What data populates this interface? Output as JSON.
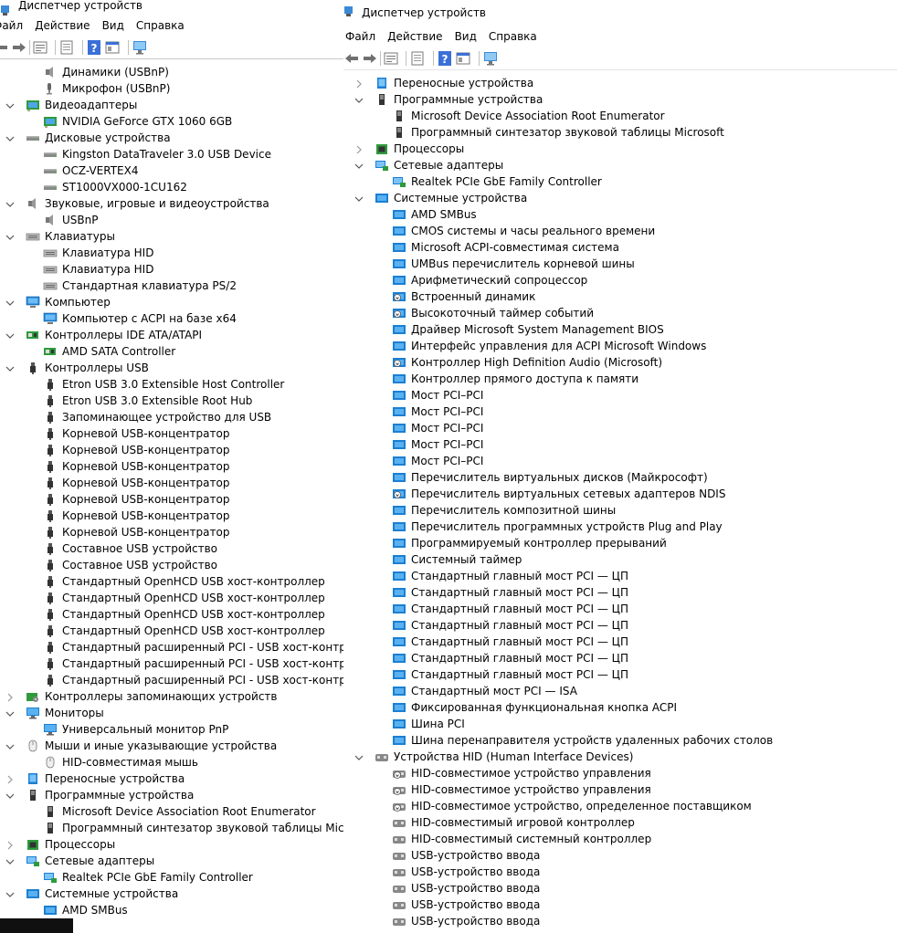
{
  "window_left": {
    "title": "Диспетчер устройств",
    "menu": [
      "Файл",
      "Действие",
      "Вид",
      "Справка"
    ],
    "tree": [
      {
        "label": "Динамики (USBnP)",
        "level": 1,
        "icon": "speaker-icon"
      },
      {
        "label": "Микрофон (USBnP)",
        "level": 1,
        "icon": "microphone-icon"
      },
      {
        "label": "Видеоадаптеры",
        "level": 0,
        "expanded": true,
        "icon": "display-adapter-icon"
      },
      {
        "label": "NVIDIA GeForce GTX 1060 6GB",
        "level": 1,
        "icon": "display-adapter-icon"
      },
      {
        "label": "Дисковые устройства",
        "level": 0,
        "expanded": true,
        "icon": "disk-drive-icon"
      },
      {
        "label": "Kingston DataTraveler 3.0 USB Device",
        "level": 1,
        "icon": "disk-drive-icon"
      },
      {
        "label": "OCZ-VERTEX4",
        "level": 1,
        "icon": "disk-drive-icon"
      },
      {
        "label": "ST1000VX000-1CU162",
        "level": 1,
        "icon": "disk-drive-icon"
      },
      {
        "label": "Звуковые, игровые и видеоустройства",
        "level": 0,
        "expanded": true,
        "icon": "speaker-icon"
      },
      {
        "label": "USBnP",
        "level": 1,
        "icon": "speaker-icon"
      },
      {
        "label": "Клавиатуры",
        "level": 0,
        "expanded": true,
        "icon": "keyboard-icon"
      },
      {
        "label": "Клавиатура HID",
        "level": 1,
        "icon": "keyboard-icon"
      },
      {
        "label": "Клавиатура HID",
        "level": 1,
        "icon": "keyboard-icon"
      },
      {
        "label": "Стандартная клавиатура PS/2",
        "level": 1,
        "icon": "keyboard-icon"
      },
      {
        "label": "Компьютер",
        "level": 0,
        "expanded": true,
        "icon": "computer-icon"
      },
      {
        "label": "Компьютер с ACPI на базе x64",
        "level": 1,
        "icon": "computer-icon"
      },
      {
        "label": "Контроллеры IDE ATA/ATAPI",
        "level": 0,
        "expanded": true,
        "icon": "ide-controller-icon"
      },
      {
        "label": "AMD SATA Controller",
        "level": 1,
        "icon": "ide-controller-icon"
      },
      {
        "label": "Контроллеры USB",
        "level": 0,
        "expanded": true,
        "icon": "usb-icon"
      },
      {
        "label": "Etron USB 3.0 Extensible Host Controller",
        "level": 1,
        "icon": "usb-icon"
      },
      {
        "label": "Etron USB 3.0 Extensible Root Hub",
        "level": 1,
        "icon": "usb-icon"
      },
      {
        "label": "Запоминающее устройство для USB",
        "level": 1,
        "icon": "usb-icon"
      },
      {
        "label": "Корневой USB-концентратор",
        "level": 1,
        "icon": "usb-icon"
      },
      {
        "label": "Корневой USB-концентратор",
        "level": 1,
        "icon": "usb-icon"
      },
      {
        "label": "Корневой USB-концентратор",
        "level": 1,
        "icon": "usb-icon"
      },
      {
        "label": "Корневой USB-концентратор",
        "level": 1,
        "icon": "usb-icon"
      },
      {
        "label": "Корневой USB-концентратор",
        "level": 1,
        "icon": "usb-icon"
      },
      {
        "label": "Корневой USB-концентратор",
        "level": 1,
        "icon": "usb-icon"
      },
      {
        "label": "Корневой USB-концентратор",
        "level": 1,
        "icon": "usb-icon"
      },
      {
        "label": "Составное USB устройство",
        "level": 1,
        "icon": "usb-icon"
      },
      {
        "label": "Составное USB устройство",
        "level": 1,
        "icon": "usb-icon"
      },
      {
        "label": "Стандартный OpenHCD USB хост-контроллер",
        "level": 1,
        "icon": "usb-icon"
      },
      {
        "label": "Стандартный OpenHCD USB хост-контроллер",
        "level": 1,
        "icon": "usb-icon"
      },
      {
        "label": "Стандартный OpenHCD USB хост-контроллер",
        "level": 1,
        "icon": "usb-icon"
      },
      {
        "label": "Стандартный OpenHCD USB хост-контроллер",
        "level": 1,
        "icon": "usb-icon"
      },
      {
        "label": "Стандартный расширенный PCI - USB хост-контроллер",
        "level": 1,
        "icon": "usb-icon"
      },
      {
        "label": "Стандартный расширенный PCI - USB хост-контроллер",
        "level": 1,
        "icon": "usb-icon"
      },
      {
        "label": "Стандартный расширенный PCI - USB хост-контроллер",
        "level": 1,
        "icon": "usb-icon"
      },
      {
        "label": "Контроллеры запоминающих устройств",
        "level": 0,
        "expanded": false,
        "icon": "storage-controller-icon"
      },
      {
        "label": "Мониторы",
        "level": 0,
        "expanded": true,
        "icon": "monitor-icon"
      },
      {
        "label": "Универсальный монитор PnP",
        "level": 1,
        "icon": "monitor-icon"
      },
      {
        "label": "Мыши и иные указывающие устройства",
        "level": 0,
        "expanded": true,
        "icon": "mouse-icon"
      },
      {
        "label": "HID-совместимая мышь",
        "level": 1,
        "icon": "mouse-icon"
      },
      {
        "label": "Переносные устройства",
        "level": 0,
        "expanded": false,
        "icon": "portable-device-icon"
      },
      {
        "label": "Программные устройства",
        "level": 0,
        "expanded": true,
        "icon": "software-device-icon"
      },
      {
        "label": "Microsoft Device Association Root Enumerator",
        "level": 1,
        "icon": "software-device-icon"
      },
      {
        "label": "Программный синтезатор звуковой таблицы Microsoft",
        "level": 1,
        "icon": "software-device-icon"
      },
      {
        "label": "Процессоры",
        "level": 0,
        "expanded": false,
        "icon": "processor-icon"
      },
      {
        "label": "Сетевые адаптеры",
        "level": 0,
        "expanded": true,
        "icon": "network-adapter-icon"
      },
      {
        "label": "Realtek PCIe GbE Family Controller",
        "level": 1,
        "icon": "network-adapter-icon"
      },
      {
        "label": "Системные устройства",
        "level": 0,
        "expanded": true,
        "icon": "system-device-icon"
      },
      {
        "label": "AMD SMBus",
        "level": 1,
        "icon": "system-device-icon"
      }
    ]
  },
  "window_right": {
    "title": "Диспетчер устройств",
    "menu": [
      "Файл",
      "Действие",
      "Вид",
      "Справка"
    ],
    "tree": [
      {
        "label": "Переносные устройства",
        "level": 0,
        "expanded": false,
        "icon": "portable-device-icon"
      },
      {
        "label": "Программные устройства",
        "level": 0,
        "expanded": true,
        "icon": "software-device-icon"
      },
      {
        "label": "Microsoft Device Association Root Enumerator",
        "level": 1,
        "icon": "software-device-icon"
      },
      {
        "label": "Программный синтезатор звуковой таблицы Microsoft",
        "level": 1,
        "icon": "software-device-icon"
      },
      {
        "label": "Процессоры",
        "level": 0,
        "expanded": false,
        "icon": "processor-icon"
      },
      {
        "label": "Сетевые адаптеры",
        "level": 0,
        "expanded": true,
        "icon": "network-adapter-icon"
      },
      {
        "label": "Realtek PCIe GbE Family Controller",
        "level": 1,
        "icon": "network-adapter-icon"
      },
      {
        "label": "Системные устройства",
        "level": 0,
        "expanded": true,
        "icon": "system-device-icon"
      },
      {
        "label": "AMD SMBus",
        "level": 1,
        "icon": "system-device-icon"
      },
      {
        "label": "CMOS системы и часы реального времени",
        "level": 1,
        "icon": "system-device-icon"
      },
      {
        "label": "Microsoft ACPI-совместимая система",
        "level": 1,
        "icon": "system-device-icon"
      },
      {
        "label": "UMBus перечислитель корневой шины",
        "level": 1,
        "icon": "system-device-icon"
      },
      {
        "label": "Арифметический сопроцессор",
        "level": 1,
        "icon": "system-device-icon"
      },
      {
        "label": "Встроенный динамик",
        "level": 1,
        "icon": "system-device-warning-icon"
      },
      {
        "label": "Высокоточный таймер событий",
        "level": 1,
        "icon": "system-device-warning-icon"
      },
      {
        "label": "Драйвер Microsoft System Management BIOS",
        "level": 1,
        "icon": "system-device-icon"
      },
      {
        "label": "Интерфейс управления для ACPI Microsoft Windows",
        "level": 1,
        "icon": "system-device-icon"
      },
      {
        "label": "Контроллер High Definition Audio (Microsoft)",
        "level": 1,
        "icon": "system-device-warning-icon"
      },
      {
        "label": "Контроллер прямого доступа к памяти",
        "level": 1,
        "icon": "system-device-icon"
      },
      {
        "label": "Мост PCI–PCI",
        "level": 1,
        "icon": "system-device-icon"
      },
      {
        "label": "Мост PCI–PCI",
        "level": 1,
        "icon": "system-device-icon"
      },
      {
        "label": "Мост PCI–PCI",
        "level": 1,
        "icon": "system-device-icon"
      },
      {
        "label": "Мост PCI–PCI",
        "level": 1,
        "icon": "system-device-icon"
      },
      {
        "label": "Мост PCI–PCI",
        "level": 1,
        "icon": "system-device-icon"
      },
      {
        "label": "Перечислитель виртуальных дисков (Майкрософт)",
        "level": 1,
        "icon": "system-device-icon"
      },
      {
        "label": "Перечислитель виртуальных сетевых адаптеров NDIS",
        "level": 1,
        "icon": "system-device-warning-icon"
      },
      {
        "label": "Перечислитель композитной шины",
        "level": 1,
        "icon": "system-device-icon"
      },
      {
        "label": "Перечислитель программных устройств Plug and Play",
        "level": 1,
        "icon": "system-device-icon"
      },
      {
        "label": "Программируемый контроллер прерываний",
        "level": 1,
        "icon": "system-device-icon"
      },
      {
        "label": "Системный таймер",
        "level": 1,
        "icon": "system-device-icon"
      },
      {
        "label": "Стандартный главный мост PCI — ЦП",
        "level": 1,
        "icon": "system-device-icon"
      },
      {
        "label": "Стандартный главный мост PCI — ЦП",
        "level": 1,
        "icon": "system-device-icon"
      },
      {
        "label": "Стандартный главный мост PCI — ЦП",
        "level": 1,
        "icon": "system-device-icon"
      },
      {
        "label": "Стандартный главный мост PCI — ЦП",
        "level": 1,
        "icon": "system-device-icon"
      },
      {
        "label": "Стандартный главный мост PCI — ЦП",
        "level": 1,
        "icon": "system-device-icon"
      },
      {
        "label": "Стандартный главный мост PCI — ЦП",
        "level": 1,
        "icon": "system-device-icon"
      },
      {
        "label": "Стандартный главный мост PCI — ЦП",
        "level": 1,
        "icon": "system-device-icon"
      },
      {
        "label": "Стандартный мост PCI — ISA",
        "level": 1,
        "icon": "system-device-icon"
      },
      {
        "label": "Фиксированная функциональная кнопка ACPI",
        "level": 1,
        "icon": "system-device-icon"
      },
      {
        "label": "Шина PCI",
        "level": 1,
        "icon": "system-device-icon"
      },
      {
        "label": "Шина перенаправителя устройств удаленных рабочих столов",
        "level": 1,
        "icon": "system-device-icon"
      },
      {
        "label": "Устройства HID (Human Interface Devices)",
        "level": 0,
        "expanded": true,
        "icon": "hid-device-icon"
      },
      {
        "label": "HID-совместимое устройство управления",
        "level": 1,
        "icon": "hid-device-warning-icon"
      },
      {
        "label": "HID-совместимое устройство управления",
        "level": 1,
        "icon": "hid-device-warning-icon"
      },
      {
        "label": "HID-совместимое устройство, определенное поставщиком",
        "level": 1,
        "icon": "hid-device-warning-icon"
      },
      {
        "label": "HID-совместимый игровой контроллер",
        "level": 1,
        "icon": "hid-device-icon"
      },
      {
        "label": "HID-совместимый системный контроллер",
        "level": 1,
        "icon": "hid-device-icon"
      },
      {
        "label": "USB-устройство ввода",
        "level": 1,
        "icon": "hid-device-icon"
      },
      {
        "label": "USB-устройство ввода",
        "level": 1,
        "icon": "hid-device-icon"
      },
      {
        "label": "USB-устройство ввода",
        "level": 1,
        "icon": "hid-device-icon"
      },
      {
        "label": "USB-устройство ввода",
        "level": 1,
        "icon": "hid-device-icon"
      },
      {
        "label": "USB-устройство ввода",
        "level": 1,
        "icon": "hid-device-icon"
      }
    ]
  },
  "toolbar_icons": [
    "back-arrow-icon",
    "forward-arrow-icon",
    "properties-icon",
    "update-driver-icon",
    "help-icon",
    "view-icon",
    "scan-hardware-icon"
  ],
  "colors": {
    "blue_icon": "#1a7fd4",
    "chevron": "#555555",
    "separator": "#c0c0c0"
  }
}
